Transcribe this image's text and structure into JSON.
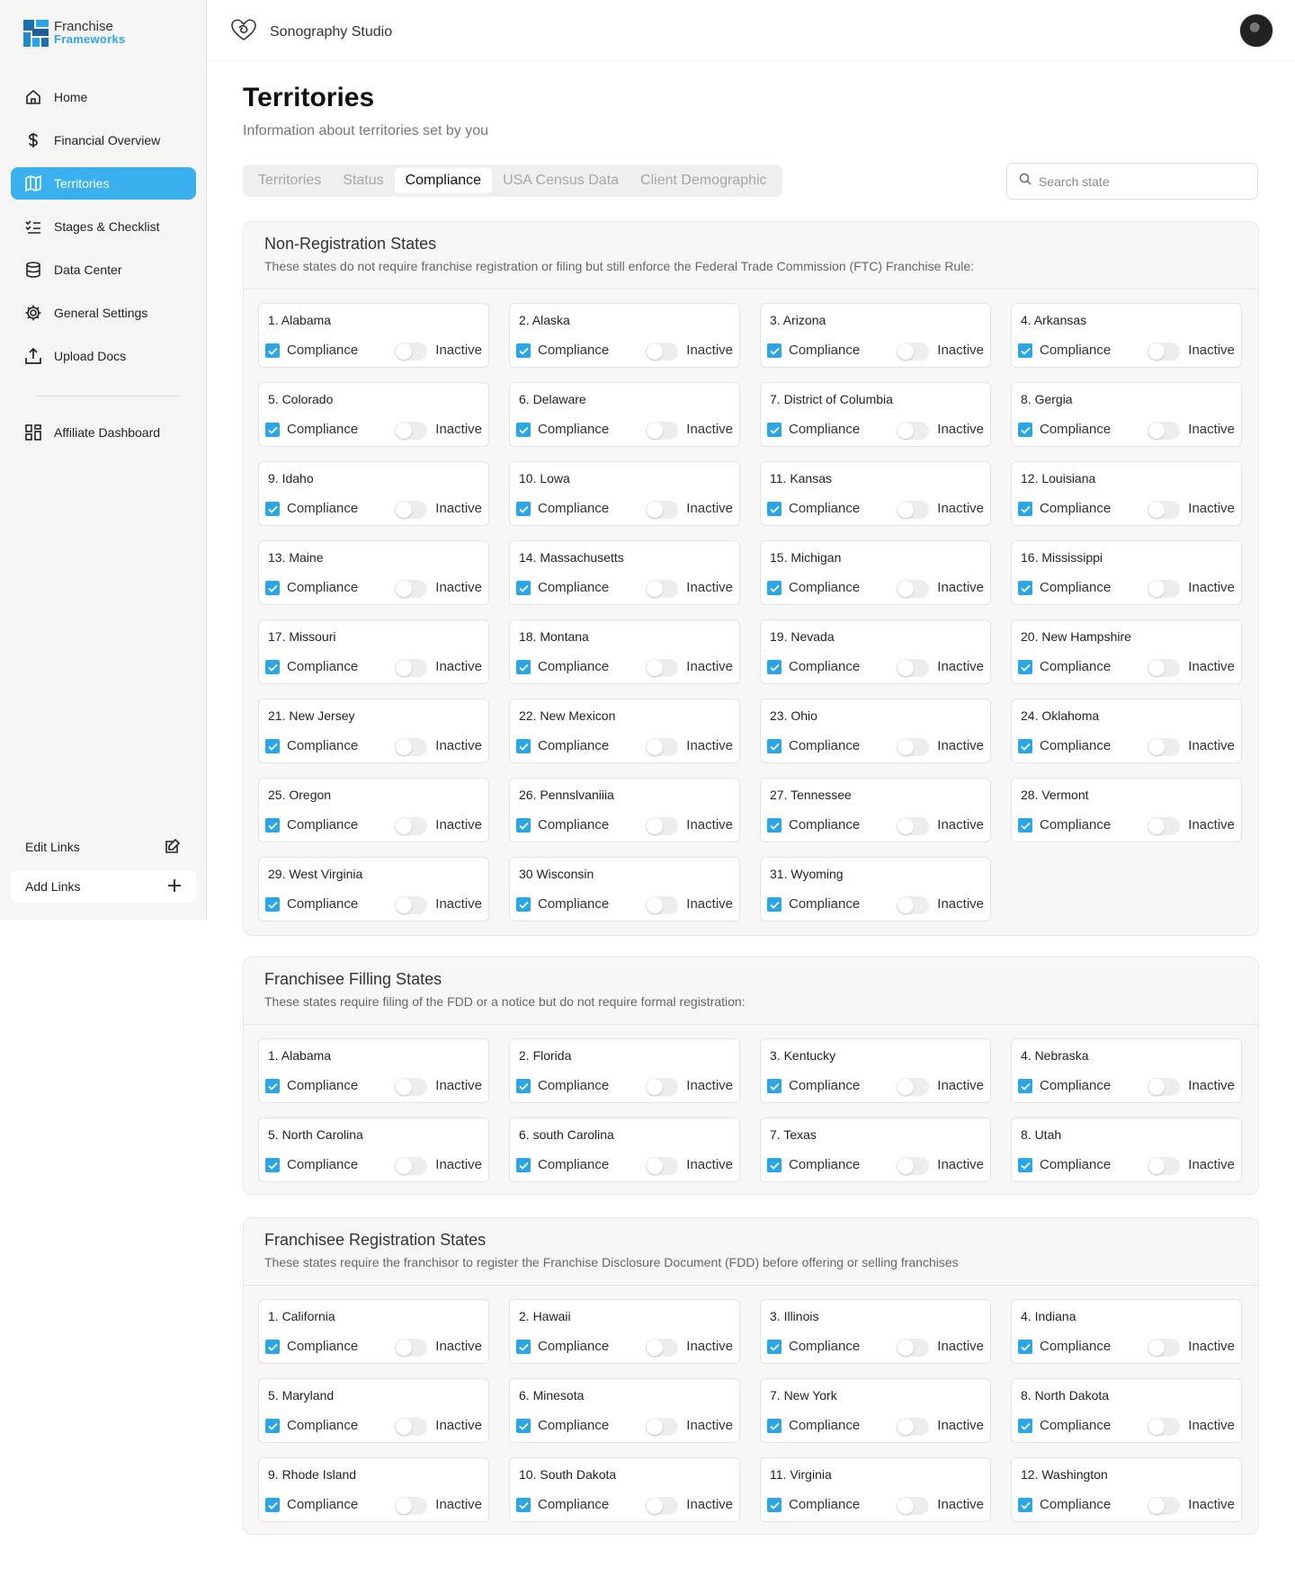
{
  "app": {
    "logo_line1": "Franchise",
    "logo_line2": "Frameworks",
    "brand_name": "Sonography Studio"
  },
  "sidebar": {
    "items": [
      {
        "label": "Home",
        "icon": "home-icon"
      },
      {
        "label": "Financial Overview",
        "icon": "dollar-icon"
      },
      {
        "label": "Territories",
        "icon": "map-icon",
        "active": true
      },
      {
        "label": "Stages & Checklist",
        "icon": "checklist-icon"
      },
      {
        "label": "Data Center",
        "icon": "database-icon"
      },
      {
        "label": "General Settings",
        "icon": "gear-icon"
      },
      {
        "label": "Upload Docs",
        "icon": "upload-icon"
      }
    ],
    "affiliate_label": "Affiliate Dashboard",
    "edit_links": "Edit Links",
    "add_links": "Add Links"
  },
  "page": {
    "title": "Territories",
    "subtitle": "Information about territories set by you"
  },
  "tabs": [
    "Territories",
    "Status",
    "Compliance",
    "USA Census Data",
    "Client Demographic"
  ],
  "active_tab": "Compliance",
  "search": {
    "placeholder": "Search state",
    "value": ""
  },
  "labels": {
    "compliance": "Compliance",
    "status": "Inactive"
  },
  "colors": {
    "accent": "#3bb0ef",
    "checkbox": "#2aa5e6"
  },
  "sections": [
    {
      "title": "Non-Registration States",
      "description": "These states do not require franchise registration or filing but still enforce the Federal Trade Commission (FTC) Franchise Rule:",
      "states": [
        "1. Alabama",
        "2. Alaska",
        "3. Arizona",
        "4. Arkansas",
        "5. Colorado",
        "6. Delaware",
        "7. District of Columbia",
        "8. Gergia",
        "9. Idaho",
        "10. Lowa",
        "11. Kansas",
        "12. Louisiana",
        "13. Maine",
        "14. Massachusetts",
        "15. Michigan",
        "16. Mississippi",
        "17. Missouri",
        "18. Montana",
        "19. Nevada",
        "20. New Hampshire",
        "21. New Jersey",
        "22. New Mexicon",
        "23. Ohio",
        "24. Oklahoma",
        "25. Oregon",
        "26. Pennslvaniiia",
        "27. Tennessee",
        "28. Vermont",
        "29. West Virginia",
        "30 Wisconsin",
        "31. Wyoming"
      ]
    },
    {
      "title": "Franchisee Filling States",
      "description": "These states require filing of the FDD or a notice but do not require formal registration:",
      "states": [
        "1. Alabama",
        "2. Florida",
        "3. Kentucky",
        "4. Nebraska",
        "5. North Carolina",
        "6. south Carolina",
        "7. Texas",
        "8. Utah"
      ]
    },
    {
      "title": "Franchisee Registration States",
      "description": "These states require the franchisor to register the Franchise Disclosure Document (FDD) before offering or selling franchises",
      "states": [
        "1. California",
        "2. Hawaii",
        "3. Illinois",
        "4. Indiana",
        "5. Maryland",
        "6. Minesota",
        "7. New York",
        "8. North Dakota",
        "9. Rhode Island",
        "10. South Dakota",
        "11. Virginia",
        "12. Washington"
      ]
    }
  ]
}
